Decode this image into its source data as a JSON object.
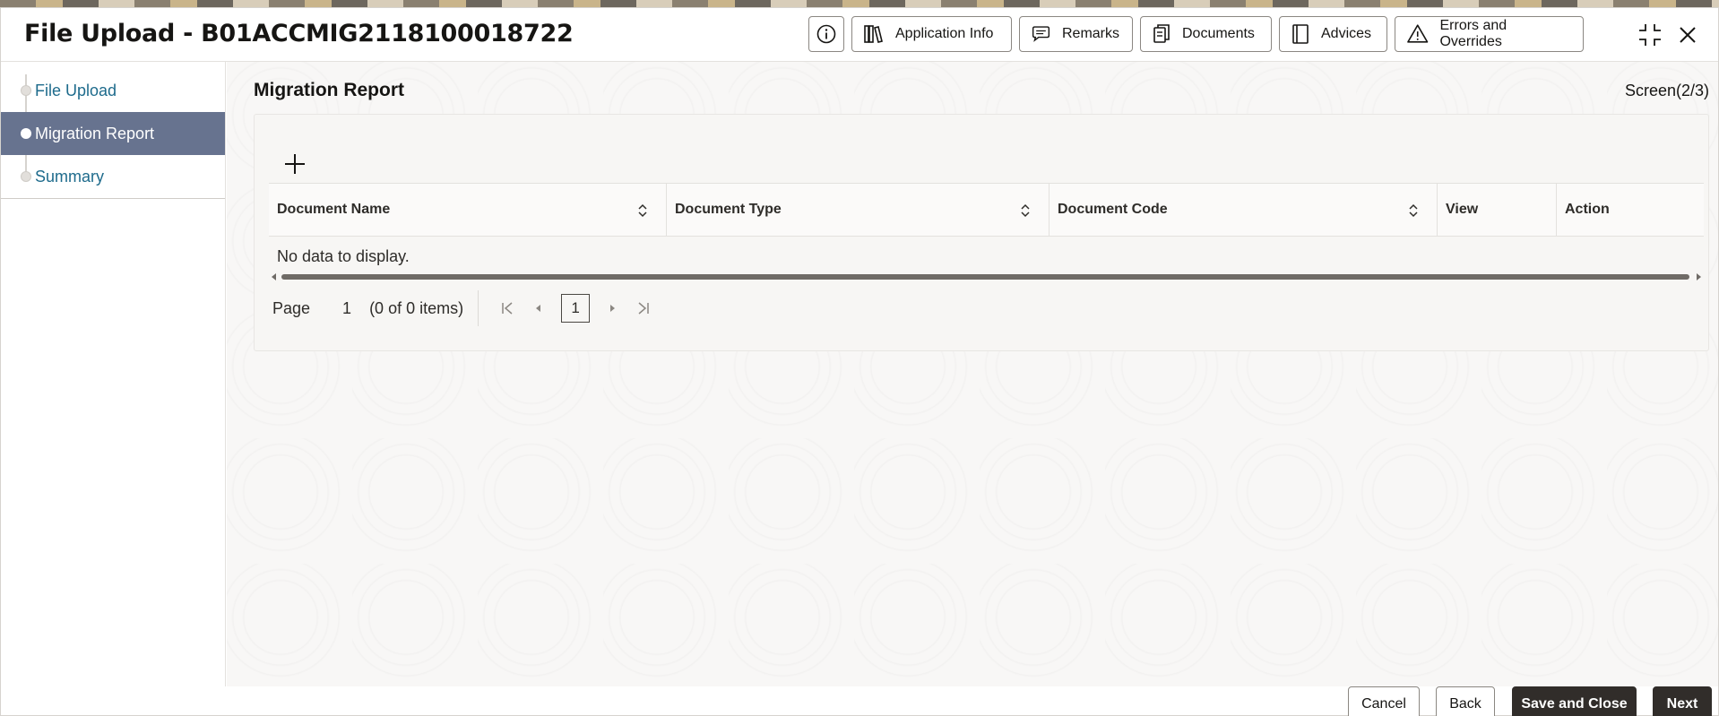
{
  "header": {
    "title": "File Upload - B01ACCMIG2118100018722",
    "buttons": {
      "application_info": "Application Info",
      "remarks": "Remarks",
      "documents": "Documents",
      "advices": "Advices",
      "errors_overrides": "Errors and Overrides"
    }
  },
  "sidebar": {
    "items": [
      {
        "label": "File Upload",
        "active": false
      },
      {
        "label": "Migration Report",
        "active": true
      },
      {
        "label": "Summary",
        "active": false
      }
    ]
  },
  "main": {
    "section_title": "Migration Report",
    "screen_label": "Screen(2/3)",
    "table": {
      "columns": [
        "Document Name",
        "Document Type",
        "Document Code",
        "View",
        "Action"
      ],
      "empty_message": "No data to display."
    },
    "pager": {
      "label": "Page",
      "current_page": "1",
      "items_text": "(0 of 0 items)",
      "page_box": "1"
    }
  },
  "footer": {
    "cancel": "Cancel",
    "back": "Back",
    "save_close": "Save and Close",
    "next": "Next"
  },
  "icons": [
    "info-icon",
    "application-info-icon",
    "remarks-icon",
    "documents-icon",
    "advices-icon",
    "warning-icon",
    "collapse-icon",
    "close-icon",
    "add-icon",
    "sort-icon",
    "first-page-icon",
    "prev-page-icon",
    "next-page-icon",
    "last-page-icon"
  ]
}
